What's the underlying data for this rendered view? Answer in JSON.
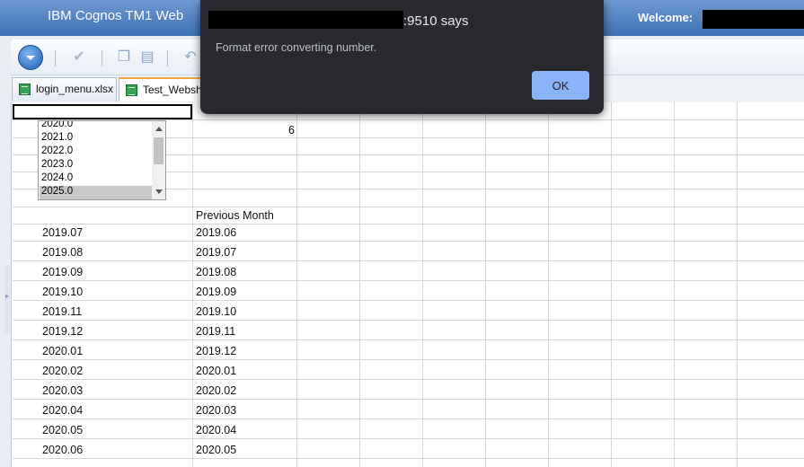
{
  "app": {
    "title": "IBM Cognos TM1 Web",
    "welcome_label": "Welcome:"
  },
  "tabs": [
    {
      "label": "login_menu.xlsx"
    },
    {
      "label": "Test_Websh"
    }
  ],
  "sheet": {
    "year_options": [
      "2020.0",
      "2021.0",
      "2022.0",
      "2023.0",
      "2024.0",
      "2025.0"
    ],
    "selected_year": "2025.0",
    "value_cell": "6",
    "header_previous": "Previous Month",
    "rows": [
      {
        "month": "2019.07",
        "prev": "2019.06"
      },
      {
        "month": "2019.08",
        "prev": "2019.07"
      },
      {
        "month": "2019.09",
        "prev": "2019.08"
      },
      {
        "month": "2019.10",
        "prev": "2019.09"
      },
      {
        "month": "2019.11",
        "prev": "2019.10"
      },
      {
        "month": "2019.12",
        "prev": "2019.11"
      },
      {
        "month": "2020.01",
        "prev": "2019.12"
      },
      {
        "month": "2020.02",
        "prev": "2020.01"
      },
      {
        "month": "2020.03",
        "prev": "2020.02"
      },
      {
        "month": "2020.04",
        "prev": "2020.03"
      },
      {
        "month": "2020.05",
        "prev": "2020.04"
      },
      {
        "month": "2020.06",
        "prev": "2020.05"
      }
    ]
  },
  "dialog": {
    "title_suffix": ":9510 says",
    "message": "Format error converting number.",
    "ok_label": "OK"
  },
  "colors": {
    "header_blue": "#3d6fb2",
    "dialog_bg": "#292a2d",
    "ok_button": "#8ab4f8",
    "tab_accent": "#f0a640"
  }
}
